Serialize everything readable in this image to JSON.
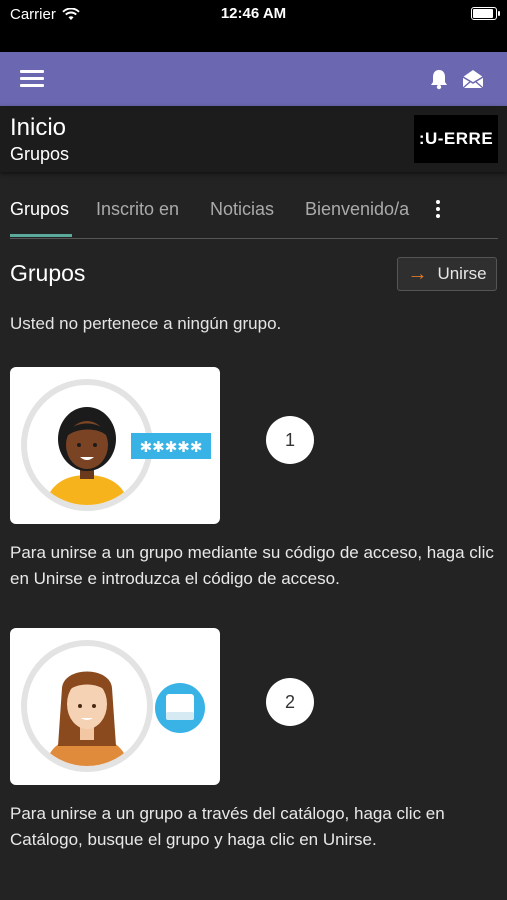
{
  "status_bar": {
    "carrier": "Carrier",
    "time": "12:46 AM"
  },
  "app_bar": {
    "menu_icon": "hamburger-icon",
    "notification_icon": "bell-icon",
    "messages_icon": "envelope-open-icon",
    "color": "#6b67b0"
  },
  "header": {
    "title": "Inicio",
    "subtitle": "Grupos",
    "logo_text": ":U-ERRE"
  },
  "tabs": [
    {
      "label": "Grupos",
      "active": true
    },
    {
      "label": "Inscrito en",
      "active": false
    },
    {
      "label": "Noticias",
      "active": false
    },
    {
      "label": "Bienvenido/a",
      "active": false
    }
  ],
  "section": {
    "title": "Grupos",
    "join_button_label": "Unirse",
    "empty_message": "Usted no pertenece a ningún grupo."
  },
  "steps": [
    {
      "number": "1",
      "text": "Para unirse a un grupo mediante su código de acceso, haga clic en Unirse e introduzca el código de acceso.",
      "badge_text": "✱✱✱✱✱"
    },
    {
      "number": "2",
      "text": "Para unirse a un grupo a través del catálogo, haga clic en Catálogo, busque el grupo y haga clic en Unirse."
    }
  ],
  "colors": {
    "accent_tab": "#5aa99a",
    "join_arrow": "#e07a2a",
    "background": "#232323"
  }
}
